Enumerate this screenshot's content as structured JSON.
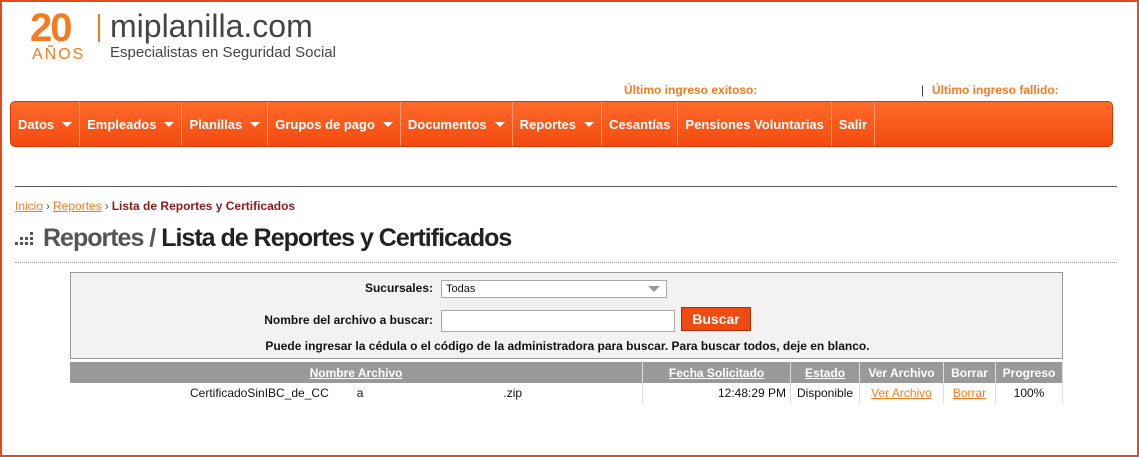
{
  "logo": {
    "number": "20",
    "years": "AÑOS",
    "name": "miplanilla.com",
    "tagline": "Especialistas en Seguridad Social"
  },
  "login": {
    "last_success_label": "Último ingreso exitoso:",
    "separator": "|",
    "last_fail_label": "Último ingreso fallido:"
  },
  "nav": {
    "items": [
      {
        "label": "Datos"
      },
      {
        "label": "Empleados"
      },
      {
        "label": "Planillas"
      },
      {
        "label": "Grupos de pago"
      },
      {
        "label": "Documentos"
      },
      {
        "label": "Reportes"
      },
      {
        "label": "Cesantías"
      },
      {
        "label": "Pensiones Voluntarias"
      },
      {
        "label": "Salir"
      }
    ]
  },
  "breadcrumb": {
    "home": "Inicio",
    "sep": "›",
    "reports": "Reportes",
    "current": "Lista de Reportes y Certificados"
  },
  "page_title": {
    "section": "Reportes /",
    "title": "Lista de Reportes y Certificados"
  },
  "search": {
    "branches_label": "Sucursales:",
    "branches_value": "Todas",
    "filename_label": "Nombre del archivo a buscar:",
    "filename_value": "",
    "button_label": "Buscar",
    "hint": "Puede ingresar la cédula o el código de la administradora para buscar. Para buscar todos, deje en blanco."
  },
  "table": {
    "headers": {
      "name": "Nombre Archivo",
      "date": "Fecha Solicitado",
      "status": "Estado",
      "view": "Ver Archivo",
      "delete": "Borrar",
      "progress": "Progreso"
    },
    "rows": [
      {
        "name_start": "CertificadoSinIBC_de_CC",
        "name_mid": "a",
        "name_end": ".zip",
        "time": "12:48:29 PM",
        "status": "Disponible",
        "view": "Ver Archivo",
        "delete": "Borrar",
        "progress": "100%"
      }
    ]
  },
  "colors": {
    "brand_orange": "#f47b20",
    "nav_orange": "#f24a0f",
    "frame_border": "#e8481e"
  }
}
